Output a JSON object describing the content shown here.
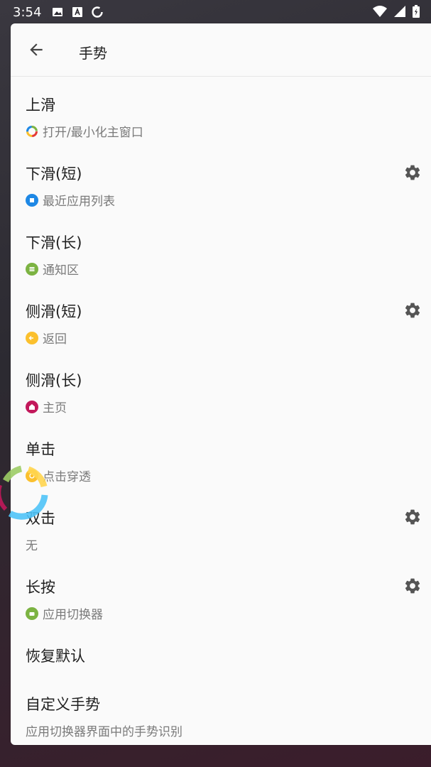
{
  "status_bar": {
    "time": "3:54",
    "icons_left": [
      "image-icon",
      "text-a-icon",
      "sync-icon"
    ],
    "icons_right": [
      "wifi-icon",
      "signal-icon",
      "battery-charging-icon"
    ]
  },
  "header": {
    "title": "手势"
  },
  "items": [
    {
      "title": "上滑",
      "subtitle": "打开/最小化主窗口",
      "icon": "ring-multicolor-icon",
      "icon_color": "#e53935",
      "has_settings": false
    },
    {
      "title": "下滑(短)",
      "subtitle": "最近应用列表",
      "icon": "recents-icon",
      "icon_color": "#1e88e5",
      "has_settings": true
    },
    {
      "title": "下滑(长)",
      "subtitle": "通知区",
      "icon": "notification-icon",
      "icon_color": "#7cb342",
      "has_settings": false
    },
    {
      "title": "侧滑(短)",
      "subtitle": "返回",
      "icon": "back-arrow-icon",
      "icon_color": "#fbc02d",
      "has_settings": true
    },
    {
      "title": "侧滑(长)",
      "subtitle": "主页",
      "icon": "home-icon",
      "icon_color": "#c2185b",
      "has_settings": false
    },
    {
      "title": "单击",
      "subtitle": "点击穿透",
      "icon": "tap-through-icon",
      "icon_color": "#fbc02d",
      "has_settings": false
    },
    {
      "title": "双击",
      "subtitle": "无",
      "icon": "",
      "icon_color": "",
      "has_settings": true
    },
    {
      "title": "长按",
      "subtitle": "应用切换器",
      "icon": "app-switcher-icon",
      "icon_color": "#7cb342",
      "has_settings": true
    },
    {
      "title": "恢复默认",
      "subtitle": "",
      "icon": "",
      "icon_color": "",
      "has_settings": false
    },
    {
      "title": "自定义手势",
      "subtitle": "应用切换器界面中的手势识别",
      "icon": "",
      "icon_color": "",
      "has_settings": false
    }
  ],
  "colors": {
    "background": "#fafafa",
    "text_primary": "#212121",
    "text_secondary": "#7a7a7a",
    "gear": "#555555"
  }
}
